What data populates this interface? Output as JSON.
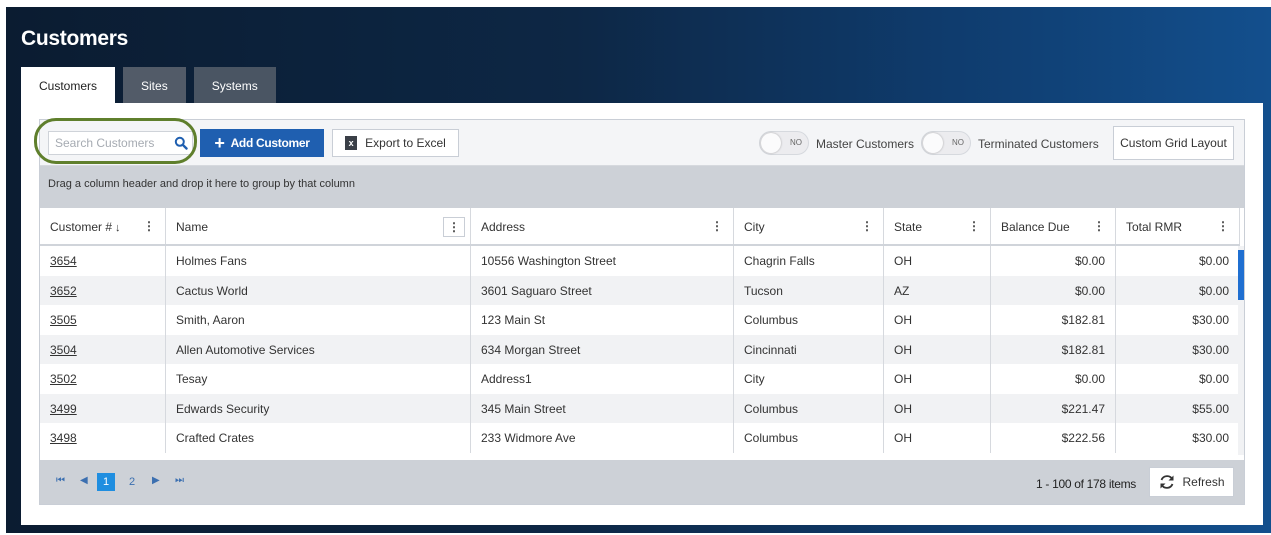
{
  "page_title": "Customers",
  "tabs": [
    {
      "label": "Customers",
      "active": true
    },
    {
      "label": "Sites",
      "active": false
    },
    {
      "label": "Systems",
      "active": false
    }
  ],
  "toolbar": {
    "search_placeholder": "Search Customers",
    "search_value": "",
    "add_label": "Add Customer",
    "export_label": "Export to Excel",
    "export_icon_letter": "x",
    "master_toggle_state": "NO",
    "master_label": "Master Customers",
    "terminated_toggle_state": "NO",
    "terminated_label": "Terminated Customers",
    "layout_label": "Custom Grid Layout"
  },
  "group_hint": "Drag a column header and drop it here to group by that column",
  "columns": [
    {
      "label": "Customer #",
      "sort_indicator": "↓"
    },
    {
      "label": "Name"
    },
    {
      "label": "Address"
    },
    {
      "label": "City"
    },
    {
      "label": "State"
    },
    {
      "label": "Balance Due"
    },
    {
      "label": "Total RMR"
    }
  ],
  "rows": [
    {
      "id": "3654",
      "name": "Holmes Fans",
      "address": "10556 Washington Street",
      "city": "Chagrin Falls",
      "state": "OH",
      "balance": "$0.00",
      "rmr": "$0.00"
    },
    {
      "id": "3652",
      "name": "Cactus World",
      "address": "3601 Saguaro Street",
      "city": "Tucson",
      "state": "AZ",
      "balance": "$0.00",
      "rmr": "$0.00"
    },
    {
      "id": "3505",
      "name": "Smith, Aaron",
      "address": "123 Main St",
      "city": "Columbus",
      "state": "OH",
      "balance": "$182.81",
      "rmr": "$30.00"
    },
    {
      "id": "3504",
      "name": "Allen Automotive Services",
      "address": "634 Morgan Street",
      "city": "Cincinnati",
      "state": "OH",
      "balance": "$182.81",
      "rmr": "$30.00"
    },
    {
      "id": "3502",
      "name": "Tesay",
      "address": "Address1",
      "city": "City",
      "state": "OH",
      "balance": "$0.00",
      "rmr": "$0.00"
    },
    {
      "id": "3499",
      "name": "Edwards Security",
      "address": "345 Main Street",
      "city": "Columbus",
      "state": "OH",
      "balance": "$221.47",
      "rmr": "$55.00"
    },
    {
      "id": "3498",
      "name": "Crafted Crates",
      "address": "233 Widmore Ave",
      "city": "Columbus",
      "state": "OH",
      "balance": "$222.56",
      "rmr": "$30.00"
    }
  ],
  "pager": {
    "pages": [
      "1",
      "2"
    ],
    "current_page": "1",
    "info": "1 - 100 of 178 items",
    "refresh_label": "Refresh"
  },
  "colors": {
    "primary_button": "#1f5fb0",
    "active_page": "#1f8ee0",
    "highlight_ring": "#5f7f2c",
    "scroll_thumb": "#1f6fd1"
  }
}
